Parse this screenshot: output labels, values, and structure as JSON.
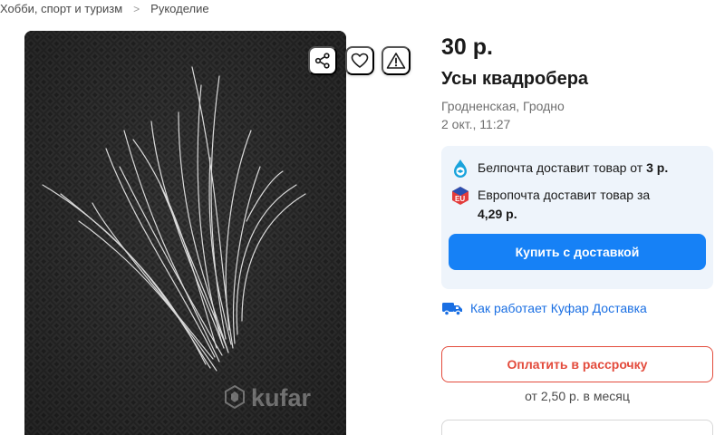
{
  "breadcrumb": {
    "items": [
      "Хобби, спорт и туризм",
      "Рукоделие"
    ],
    "separator": ">"
  },
  "gallery": {
    "watermark": "kufar",
    "actions": {
      "share_icon": "share-icon",
      "favorite_icon": "heart-icon",
      "report_icon": "warning-icon"
    }
  },
  "listing": {
    "price": "30 р.",
    "title": "Усы квадробера",
    "location": "Гродненская, Гродно",
    "date": "2 окт., 11:27"
  },
  "delivery": {
    "belpost": {
      "text": "Белпочта доставит товар от",
      "amount": "3 р.",
      "icon": "belpost-logo-icon"
    },
    "europost": {
      "text": "Европочта доставит товар за",
      "amount": "4,29 р.",
      "icon": "europost-logo-icon"
    },
    "buy_button": "Купить с доставкой",
    "how_link": "Как работает Куфар Доставка",
    "how_icon": "delivery-truck-icon"
  },
  "installment": {
    "button": "Оплатить в рассрочку",
    "note": "от 2,50 р. в месяц"
  },
  "colors": {
    "primary": "#1681f6",
    "link": "#1a6fe3",
    "danger": "#e34b3c",
    "card_bg": "#eef4fb"
  }
}
